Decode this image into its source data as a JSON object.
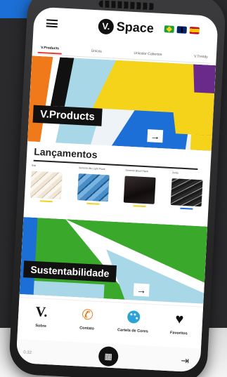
{
  "header": {
    "logo_letter": "V.",
    "brand_name": "Space",
    "languages": [
      "pt-br",
      "en",
      "es"
    ]
  },
  "tabs": [
    {
      "label": "V.Products",
      "active": true
    },
    {
      "label": "Únicos",
      "active": false
    },
    {
      "label": "Unicolor Cobertos",
      "active": false
    },
    {
      "label": "V.Trendy",
      "active": false
    }
  ],
  "hero": {
    "label": "V.Products",
    "arrow": "→"
  },
  "launches": {
    "title": "Lançamentos",
    "products": [
      {
        "name": "Bali",
        "underline_color": "#f2d21b"
      },
      {
        "name": "Sorrento Blu Light Plank",
        "underline_color": "#f2d21b"
      },
      {
        "name": "Sorrento Black Plank",
        "underline_color": "#f2d21b"
      },
      {
        "name": "Zelda",
        "underline_color": "#1c6fd6"
      }
    ]
  },
  "sustainability": {
    "label": "Sustentabilidade",
    "arrow": "→"
  },
  "bottom_nav": [
    {
      "label": "Sobre",
      "icon": "v-logo-icon"
    },
    {
      "label": "Contato",
      "icon": "phone-icon"
    },
    {
      "label": "Cartela de Cores",
      "icon": "palette-icon"
    },
    {
      "label": "Favoritos",
      "icon": "heart-icon"
    }
  ],
  "footer": {
    "version": "0.32",
    "qr_glyph": "▦",
    "logout_glyph": "⇥"
  },
  "colors": {
    "accent_orange": "#f07a1a",
    "accent_yellow": "#f6d31b",
    "accent_purple": "#6a2a8a",
    "accent_green": "#3aa82a",
    "accent_blue": "#1c6fd6"
  }
}
